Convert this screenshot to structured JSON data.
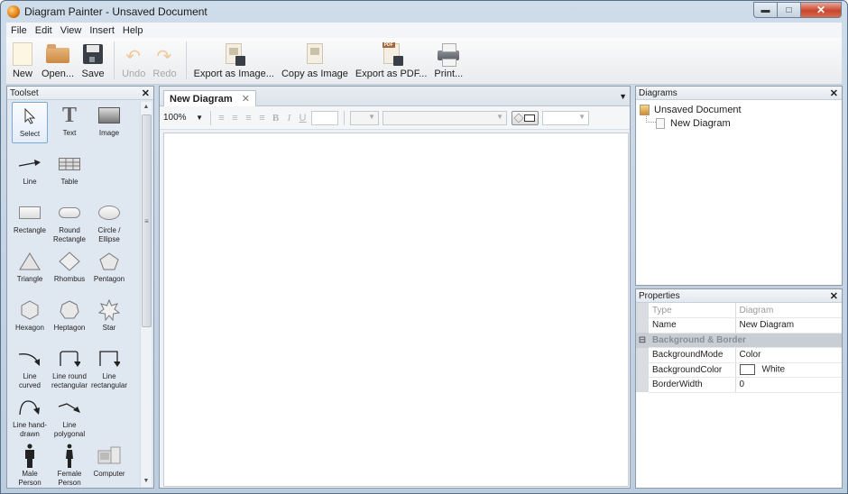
{
  "window": {
    "title": "Diagram Painter - Unsaved Document",
    "controls": {
      "minimize": "minimize",
      "maximize": "maximize",
      "close": "close"
    }
  },
  "menu": [
    "File",
    "Edit",
    "View",
    "Insert",
    "Help"
  ],
  "toolbar": {
    "new": "New",
    "open": "Open...",
    "save": "Save",
    "undo": "Undo",
    "redo": "Redo",
    "export_image": "Export as Image...",
    "copy_image": "Copy as Image",
    "export_pdf": "Export as PDF...",
    "print": "Print...",
    "pdf_badge": "PDF"
  },
  "toolset": {
    "title": "Toolset",
    "tools": [
      {
        "id": "select",
        "label": "Select",
        "selected": true
      },
      {
        "id": "text",
        "label": "Text"
      },
      {
        "id": "image",
        "label": "Image"
      },
      {
        "id": "line",
        "label": "Line"
      },
      {
        "id": "table",
        "label": "Table"
      },
      {
        "id": "rectangle",
        "label": "Rectangle"
      },
      {
        "id": "round-rectangle",
        "label": "Round Rectangle"
      },
      {
        "id": "circle-ellipse",
        "label": "Circle / Ellipse"
      },
      {
        "id": "triangle",
        "label": "Triangle"
      },
      {
        "id": "rhombus",
        "label": "Rhombus"
      },
      {
        "id": "pentagon",
        "label": "Pentagon"
      },
      {
        "id": "hexagon",
        "label": "Hexagon"
      },
      {
        "id": "heptagon",
        "label": "Heptagon"
      },
      {
        "id": "star",
        "label": "Star"
      },
      {
        "id": "line-curved",
        "label": "Line curved"
      },
      {
        "id": "line-round-rectangular",
        "label": "Line round rectangular"
      },
      {
        "id": "line-rectangular",
        "label": "Line rectangular"
      },
      {
        "id": "line-hand-drawn",
        "label": "Line hand-drawn"
      },
      {
        "id": "line-polygonal",
        "label": "Line polygonal"
      },
      {
        "id": "male-person",
        "label": "Male Person"
      },
      {
        "id": "female-person",
        "label": "Female Person"
      },
      {
        "id": "computer",
        "label": "Computer"
      }
    ]
  },
  "editor": {
    "tab": "New Diagram",
    "zoom": "100%",
    "format": {
      "bold": "B",
      "italic": "I",
      "underline": "U"
    }
  },
  "diagrams": {
    "title": "Diagrams",
    "document": "Unsaved Document",
    "children": [
      "New Diagram"
    ]
  },
  "properties": {
    "title": "Properties",
    "rows": [
      {
        "key": "Type",
        "value": "Diagram",
        "readonly": true
      },
      {
        "key": "Name",
        "value": "New Diagram"
      }
    ],
    "category": "Background & Border",
    "category_rows": [
      {
        "key": "BackgroundMode",
        "value": "Color"
      },
      {
        "key": "BackgroundColor",
        "value": "White",
        "swatch": "#ffffff"
      },
      {
        "key": "BorderWidth",
        "value": "0"
      }
    ]
  }
}
